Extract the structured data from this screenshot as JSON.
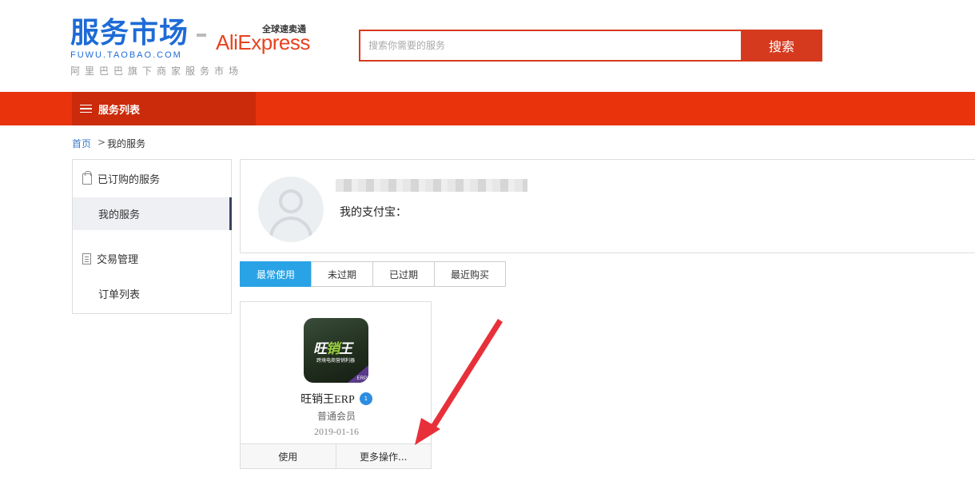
{
  "header": {
    "logo_main": "服务市场",
    "logo_sub": "FUWU.TAOBAO.COM",
    "logo_tagline": "阿里巴巴旗下商家服务市场",
    "partner_cn": "全球速卖通",
    "partner_en": "AliExpress",
    "search_placeholder": "搜索你需要的服务",
    "search_button": "搜索"
  },
  "navbar": {
    "category_label": "服务列表"
  },
  "breadcrumb": {
    "home": "首页",
    "separator": ">",
    "current": "我的服务"
  },
  "sidebar": {
    "groups": [
      {
        "label": "已订购的服务",
        "icon": "shopping-bag-icon",
        "items": [
          {
            "label": "我的服务",
            "active": true
          }
        ]
      },
      {
        "label": "交易管理",
        "icon": "document-icon",
        "items": [
          {
            "label": "订单列表",
            "active": false
          }
        ]
      }
    ]
  },
  "profile": {
    "alipay_label": "我的支付宝："
  },
  "tabs": [
    {
      "label": "最常使用",
      "active": true
    },
    {
      "label": "未过期",
      "active": false
    },
    {
      "label": "已过期",
      "active": false
    },
    {
      "label": "最近购买",
      "active": false
    }
  ],
  "service_card": {
    "icon_brand_a": "旺",
    "icon_brand_b": "销",
    "icon_brand_c": "王",
    "icon_caption": "跨境电商营销利器",
    "icon_corner": "ERP",
    "name": "旺销王ERP",
    "level_badge": "1",
    "tier": "普通会员",
    "date": "2019-01-16",
    "use_button": "使用",
    "more_button": "更多操作..."
  },
  "colors": {
    "brand_blue": "#1e6bd6",
    "nav_red": "#e8330c",
    "search_red": "#d63a1e",
    "tab_active": "#29a3e6",
    "annotation_arrow": "#e8303a"
  }
}
